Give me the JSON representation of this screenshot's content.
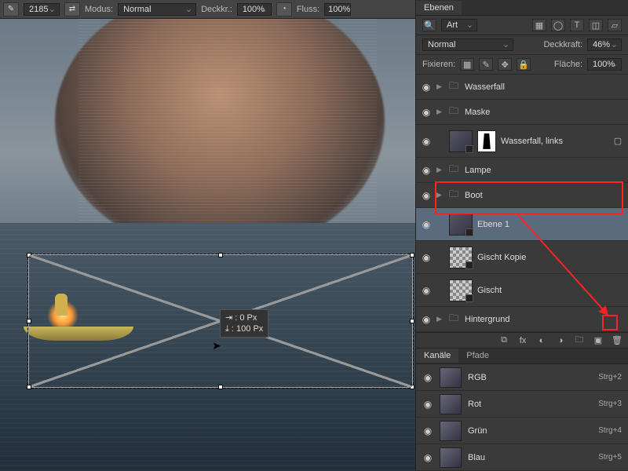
{
  "topbar": {
    "brush_size": "2185",
    "mode_label": "Modus:",
    "mode_value": "Normal",
    "opacity_label": "Deckkr.:",
    "opacity_value": "100%",
    "flow_label": "Fluss:",
    "flow_value": "100%"
  },
  "transform_tip": {
    "l1": "⇥ :   0 Px",
    "l2": "⤓ :  100 Px"
  },
  "layers_panel": {
    "tab": "Ebenen",
    "filter_label": "Art",
    "blend_mode": "Normal",
    "opacity_label": "Deckkraft:",
    "opacity_value": "46%",
    "lock_label": "Fixieren:",
    "fill_label": "Fläche:",
    "fill_value": "100%",
    "layers": [
      {
        "type": "group",
        "name": "Wasserfall"
      },
      {
        "type": "group",
        "name": "Maske"
      },
      {
        "type": "masked",
        "name": "Wasserfall, links"
      },
      {
        "type": "group",
        "name": "Lampe"
      },
      {
        "type": "group",
        "name": "Boot"
      },
      {
        "type": "smart",
        "name": "Ebene 1",
        "selected": true,
        "tall": true
      },
      {
        "type": "checker",
        "name": "Gischt Kopie",
        "tall": true
      },
      {
        "type": "checker",
        "name": "Gischt",
        "tall": true
      },
      {
        "type": "group",
        "name": "Hintergrund"
      }
    ]
  },
  "channels_panel": {
    "tab1": "Kanäle",
    "tab2": "Pfade",
    "channels": [
      {
        "name": "RGB",
        "shortcut": "Strg+2"
      },
      {
        "name": "Rot",
        "shortcut": "Strg+3"
      },
      {
        "name": "Grün",
        "shortcut": "Strg+4"
      },
      {
        "name": "Blau",
        "shortcut": "Strg+5"
      }
    ]
  },
  "icons": {
    "brush": "✎",
    "swap": "⇄",
    "airbrush": "✈",
    "eye": "◉",
    "folder": "🗀",
    "triangle": "▶",
    "link": "⧉",
    "fx": "fx",
    "mask": "◐",
    "adjust": "◑",
    "group": "🗀",
    "new": "▣",
    "trash": "🗑",
    "search": "🔍",
    "img": "▦",
    "circle": "◯",
    "text": "T",
    "crop": "◫",
    "shape": "▱",
    "lock1": "▦",
    "lock2": "✎",
    "lock3": "✥",
    "lock4": "🔒"
  }
}
